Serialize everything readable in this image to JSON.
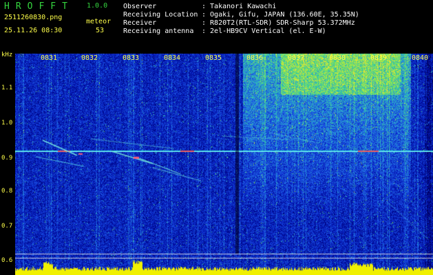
{
  "header": {
    "logo": "HROFFT",
    "version": "1.0.0",
    "filename": "2511260830.png",
    "count_type": "meteor",
    "datetime": "25.11.26 08:30",
    "count": "53",
    "info": [
      {
        "label": "Observer",
        "value": ": Takanori Kawachi"
      },
      {
        "label": "Receiving Location",
        "value": ": Ogaki, Gifu, JAPAN (136.60E, 35.35N)"
      },
      {
        "label": "Receiver",
        "value": ": R820T2(RTL-SDR) SDR-Sharp 53.372MHz"
      },
      {
        "label": "Receiving antenna",
        "value": ": 2el-HB9CV Vertical (el. E-W)"
      }
    ]
  },
  "spectrogram": {
    "y_unit": "kHz",
    "y_ticks": [
      "1.1",
      "1.0",
      "0.9",
      "0.8",
      "0.7",
      "0.6"
    ],
    "x_ticks": [
      "0831",
      "0832",
      "0833",
      "0834",
      "0835",
      "0836",
      "0837",
      "0838",
      "0839",
      "0840"
    ],
    "colors": {
      "axis_labels": "#ffff4a",
      "beacon_line": "#33e0e0",
      "intensity_band": "#f0f000"
    }
  }
}
